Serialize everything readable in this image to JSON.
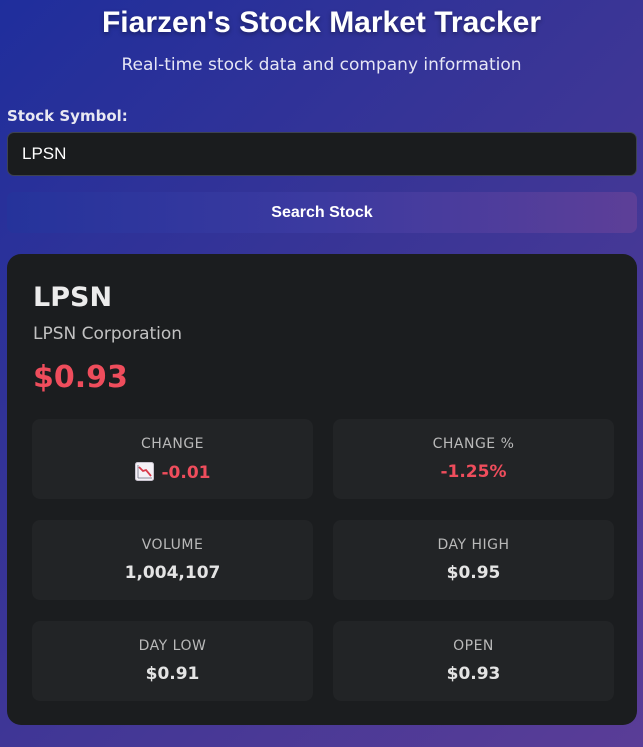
{
  "header": {
    "title": "Fiarzen's Stock Market Tracker",
    "subtitle": "Real-time stock data and company information"
  },
  "search": {
    "label": "Stock Symbol:",
    "value": "LPSN",
    "button_label": "Search Stock"
  },
  "stock": {
    "symbol": "LPSN",
    "company": "LPSN Corporation",
    "price": "$0.93",
    "stats": {
      "change": {
        "label": "CHANGE",
        "value": "-0.01",
        "icon": "chart-decreasing-icon"
      },
      "change_pct": {
        "label": "CHANGE %",
        "value": "-1.25%"
      },
      "volume": {
        "label": "VOLUME",
        "value": "1,004,107"
      },
      "day_high": {
        "label": "DAY HIGH",
        "value": "$0.95"
      },
      "day_low": {
        "label": "DAY LOW",
        "value": "$0.91"
      },
      "open": {
        "label": "OPEN",
        "value": "$0.93"
      }
    }
  },
  "colors": {
    "negative": "#ef4d5c",
    "card_bg": "#1b1d1f",
    "tile_bg": "#222426",
    "gradient_start": "#1f2e9c",
    "gradient_end": "#5a3d97"
  }
}
